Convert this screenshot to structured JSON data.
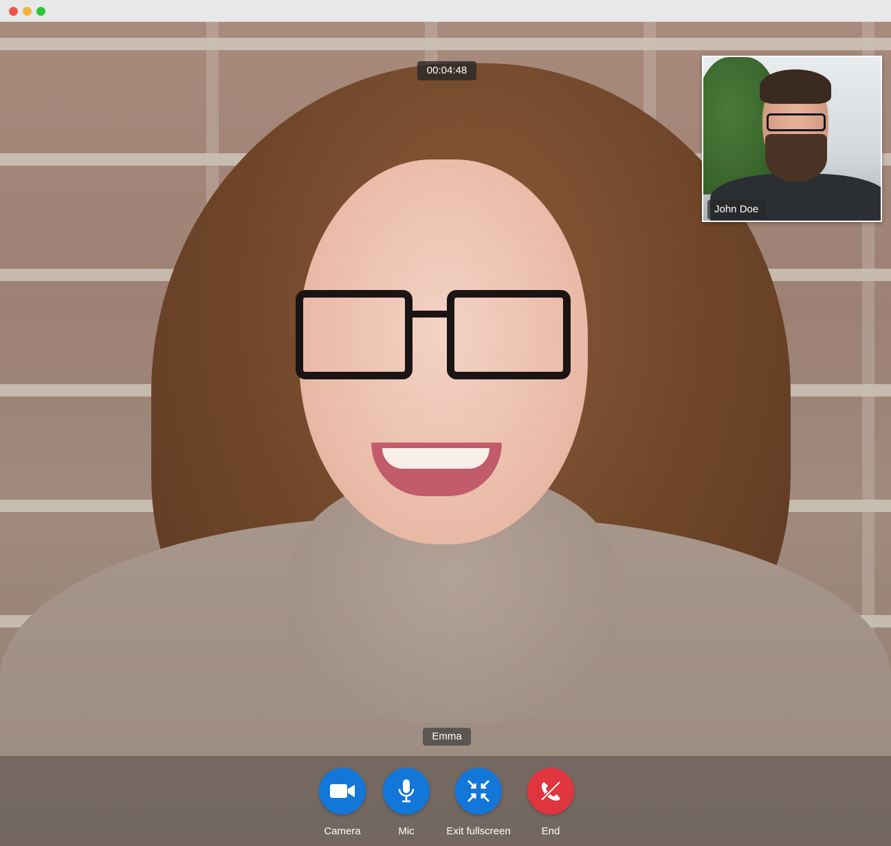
{
  "window": {
    "controls": [
      "close",
      "minimize",
      "zoom"
    ]
  },
  "call": {
    "timer": "00:04:48",
    "remote_participant": "Emma",
    "self_view_name": "John Doe"
  },
  "controls": {
    "camera_label": "Camera",
    "mic_label": "Mic",
    "exit_fullscreen_label": "Exit fullscreen",
    "end_label": "End",
    "icons": {
      "camera": "video-camera-icon",
      "mic": "microphone-icon",
      "exit_fullscreen": "exit-fullscreen-icon",
      "end": "end-call-icon"
    },
    "colors": {
      "primary": "#1277d8",
      "danger": "#e0353f"
    }
  }
}
